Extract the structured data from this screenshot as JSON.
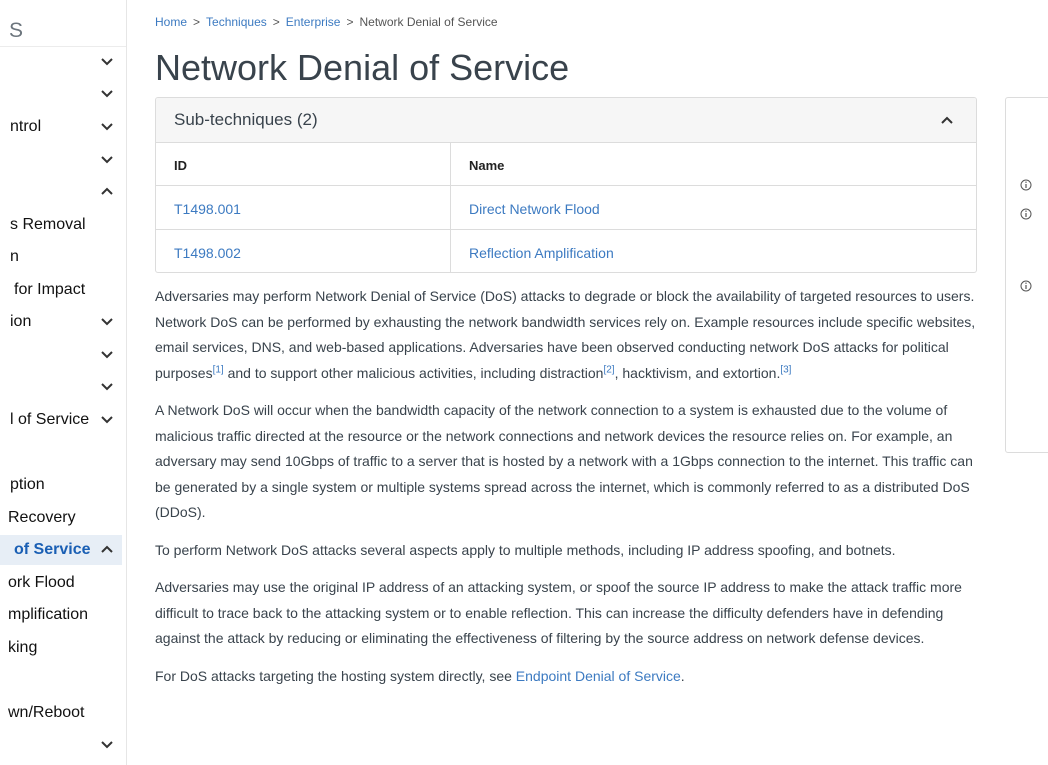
{
  "sidebar": {
    "header": "S",
    "items": [
      {
        "label": "",
        "chevron": "chevron-down-icon",
        "active": false
      },
      {
        "label": "",
        "chevron": "chevron-down-icon",
        "active": false
      },
      {
        "label": "ntrol",
        "chevron": "chevron-down-icon",
        "active": false
      },
      {
        "label": "",
        "chevron": "chevron-down-icon",
        "active": false
      },
      {
        "label": "",
        "chevron": "chevron-up-icon",
        "active": false
      },
      {
        "label": "s Removal",
        "chevron": "",
        "active": false
      },
      {
        "label": "n",
        "chevron": "",
        "active": false
      },
      {
        "label": " for Impact",
        "chevron": "",
        "active": false
      },
      {
        "label": "ion",
        "chevron": "chevron-down-icon",
        "active": false
      },
      {
        "label": "",
        "chevron": "chevron-down-icon",
        "active": false
      },
      {
        "label": "",
        "chevron": "chevron-down-icon",
        "active": false
      },
      {
        "label": "l of Service",
        "chevron": "chevron-down-icon",
        "active": false
      },
      {
        "label": "ption",
        "chevron": "",
        "active": false
      },
      {
        "label": "Recovery",
        "chevron": "",
        "active": false
      },
      {
        "label": "of Service",
        "chevron": "chevron-up-icon",
        "active": true
      },
      {
        "label": "ork Flood",
        "chevron": "",
        "active": false
      },
      {
        "label": "mplification",
        "chevron": "",
        "active": false
      },
      {
        "label": "king",
        "chevron": "",
        "active": false
      },
      {
        "label": "wn/Reboot",
        "chevron": "",
        "active": false
      },
      {
        "label": "",
        "chevron": "chevron-down-icon",
        "active": false
      }
    ]
  },
  "breadcrumb": {
    "items": [
      "Home",
      "Techniques",
      "Enterprise",
      "Network Denial of Service"
    ],
    "separator": ">"
  },
  "page_title": "Network Denial of Service",
  "subtechniques": {
    "title": "Sub-techniques (2)",
    "toggle_icon": "chevron-up-icon",
    "columns": [
      "ID",
      "Name"
    ],
    "rows": [
      {
        "id": "T1498.001",
        "name": "Direct Network Flood"
      },
      {
        "id": "T1498.002",
        "name": "Reflection Amplification"
      }
    ]
  },
  "description": {
    "p1": {
      "before_ref1": "Adversaries may perform Network Denial of Service (DoS) attacks to degrade or block the availability of targeted resources to users. Network DoS can be performed by exhausting the network bandwidth services rely on. Example resources include specific websites, email services, DNS, and web-based applications. Adversaries have been observed conducting network DoS attacks for political purposes",
      "ref1": "[1]",
      "before_ref2": " and to support other malicious activities, including distraction",
      "ref2": "[2]",
      "before_ref3": ", hacktivism, and extortion.",
      "ref3": "[3]"
    },
    "p2": "A Network DoS will occur when the bandwidth capacity of the network connection to a system is exhausted due to the volume of malicious traffic directed at the resource or the network connections and network devices the resource relies on. For example, an adversary may send 10Gbps of traffic to a server that is hosted by a network with a 1Gbps connection to the internet. This traffic can be generated by a single system or multiple systems spread across the internet, which is commonly referred to as a distributed DoS (DDoS).",
    "p3": "To perform Network DoS attacks several aspects apply to multiple methods, including IP address spoofing, and botnets.",
    "p4": "Adversaries may use the original IP address of an attacking system, or spoof the source IP address to make the attack traffic more difficult to trace back to the attacking system or to enable reflection. This can increase the difficulty defenders have in defending against the attack by reducing or eliminating the effectiveness of filtering by the source address on network defense devices.",
    "p5": {
      "before_link": "For DoS attacks targeting the hosting system directly, see ",
      "link": "Endpoint Denial of Service",
      "after_link": "."
    }
  },
  "right_panel": {
    "info_icons": [
      "info-icon",
      "info-icon",
      "info-icon"
    ]
  },
  "colors": {
    "link": "#3c7ac1",
    "active_bg": "#e7eef6",
    "border": "#dcdcdc",
    "text": "#39434c"
  }
}
